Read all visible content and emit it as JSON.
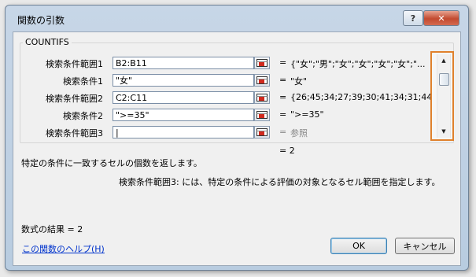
{
  "window": {
    "title": "関数の引数",
    "help_label": "?",
    "close_label": "✕"
  },
  "function_name": "COUNTIFS",
  "args": [
    {
      "label": "検索条件範囲1",
      "value": "B2:B11",
      "result": "{\"女\";\"男\";\"女\";\"女\";\"女\";\"女\";\"..."
    },
    {
      "label": "検索条件1",
      "value": "\"女\"",
      "result": "\"女\""
    },
    {
      "label": "検索条件範囲2",
      "value": "C2:C11",
      "result": "{26;45;34;27;39;30;41;34;31;44}"
    },
    {
      "label": "検索条件2",
      "value": "\">=35\"",
      "result": "\">=35\""
    },
    {
      "label": "検索条件範囲3",
      "value": "|",
      "result": "参照"
    }
  ],
  "eq_sign": "=",
  "total_result": "= 2",
  "description": "特定の条件に一致するセルの個数を返します。",
  "arg_description": "検索条件範囲3: には、特定の条件による評価の対象となるセル範囲を指定します。",
  "formula_result": "数式の結果 =   2",
  "help_link": "この関数のヘルプ(H)",
  "buttons": {
    "ok": "OK",
    "cancel": "キャンセル"
  },
  "scroll_arrows": {
    "up": "▲",
    "down": "▼"
  },
  "colors": {
    "highlight_border": "#e0812d",
    "link": "#0033cc",
    "ref_icon_red": "#d02a1e"
  }
}
